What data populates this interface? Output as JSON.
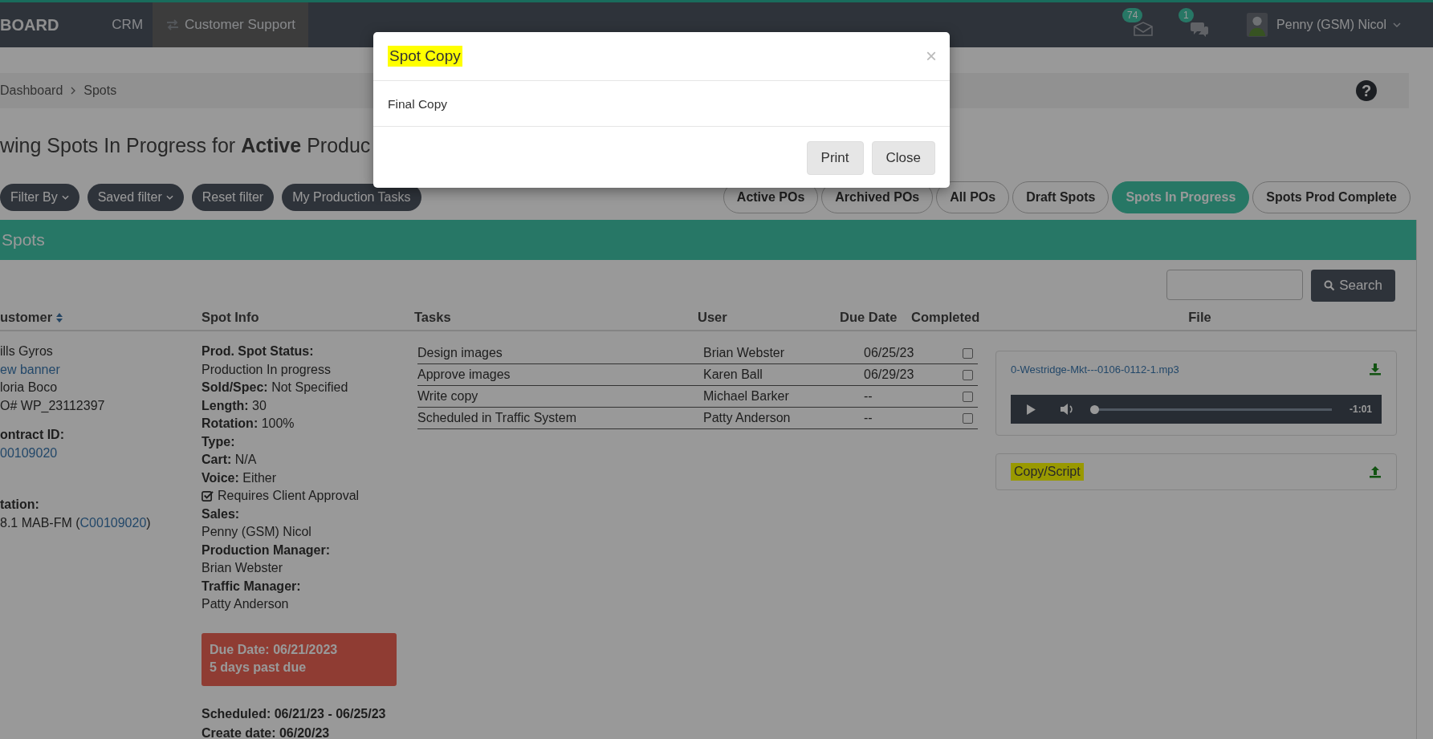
{
  "topbar": {
    "brand": "BOARD",
    "nav": [
      {
        "label": "CRM",
        "selected": false
      },
      {
        "label": "Customer Support",
        "selected": true
      }
    ],
    "mail_badge": "74",
    "chat_badge": "1",
    "user": "Penny (GSM) Nicol"
  },
  "breadcrumb": [
    "Dashboard",
    "Spots"
  ],
  "help": "?",
  "heading": "wing Spots In Progress for **Active** Produc",
  "filters": [
    {
      "label": "Filter By",
      "dropdown": true
    },
    {
      "label": "Saved filter",
      "dropdown": true
    },
    {
      "label": "Reset filter",
      "dropdown": false
    },
    {
      "label": "My Production Tasks",
      "dropdown": false
    }
  ],
  "tabs": [
    {
      "label": "Active POs",
      "selected": false
    },
    {
      "label": "Archived POs",
      "selected": false
    },
    {
      "label": "All POs",
      "selected": false
    },
    {
      "label": "Draft Spots",
      "selected": false
    },
    {
      "label": "Spots In Progress",
      "selected": true
    },
    {
      "label": "Spots Prod Complete",
      "selected": false
    }
  ],
  "panel": {
    "title": "Spots",
    "search_button": "Search"
  },
  "table": {
    "columns": [
      {
        "label": "ustomer",
        "sortable": true
      },
      {
        "label": "Spot Info",
        "sortable": false
      },
      {
        "label": "Tasks",
        "sortable": false
      },
      {
        "label": "User",
        "sortable": false
      },
      {
        "label": "Due Date",
        "sortable": false
      },
      {
        "label": "Completed",
        "sortable": false
      },
      {
        "label": "File",
        "sortable": false
      }
    ],
    "customer": [
      {
        "kind": "text",
        "text": "ills Gyros"
      },
      {
        "kind": "link",
        "text": "ew banner"
      },
      {
        "kind": "text",
        "text": "loria Boco"
      },
      {
        "kind": "text",
        "text": "O# WP_23112397"
      },
      {
        "kind": "label",
        "text": "ontract ID:"
      },
      {
        "kind": "link",
        "text": "00109020"
      },
      {
        "kind": "label",
        "text": "tation:"
      },
      {
        "kind": "station",
        "text": "8.1 MAB-FM (",
        "link": "C00109020",
        "after": ")"
      }
    ],
    "spot_info": [
      {
        "kind": "label",
        "text": "Prod. Spot Status:"
      },
      {
        "kind": "value",
        "text": "Production In progress"
      },
      {
        "kind": "rich",
        "text": "**Sold/Spec:** Not Specified"
      },
      {
        "kind": "rich",
        "text": "**Length:** 30"
      },
      {
        "kind": "rich",
        "text": "**Rotation:** 100%"
      },
      {
        "kind": "rich",
        "text": "**Type:**"
      },
      {
        "kind": "rich",
        "text": "**Cart:** N/A"
      },
      {
        "kind": "rich",
        "text": "**Voice:** Either"
      },
      {
        "kind": "check",
        "text": "Requires Client Approval",
        "checked": true
      },
      {
        "kind": "label",
        "text": "Sales:"
      },
      {
        "kind": "value",
        "text": "Penny (GSM) Nicol"
      },
      {
        "kind": "label",
        "text": "Production Manager:"
      },
      {
        "kind": "value",
        "text": "Brian Webster"
      },
      {
        "kind": "label",
        "text": "Traffic Manager:"
      },
      {
        "kind": "value",
        "text": "Patty Anderson"
      }
    ],
    "due": {
      "date": "Due Date: 06/21/2023",
      "overdue": "5 days past due"
    },
    "dates": [
      "Scheduled: 06/21/23 - 06/25/23",
      "Create date: 06/20/23"
    ],
    "tasks": [
      {
        "task": "Design images",
        "user": "Brian Webster",
        "due": "06/25/23",
        "completed": false
      },
      {
        "task": "Approve images",
        "user": "Karen Ball",
        "due": "06/29/23",
        "completed": false
      },
      {
        "task": "Write copy",
        "user": "Michael Barker",
        "due": "--",
        "completed": false
      },
      {
        "task": "Scheduled in Traffic System",
        "user": "Patty Anderson",
        "due": "--",
        "completed": false
      }
    ],
    "file": {
      "name": "0-Westridge-Mkt---0106-0112-1.mp3",
      "time": "-1:01",
      "level": 0
    },
    "copy": {
      "label": "Copy/Script",
      "highlighted": true
    }
  },
  "modal": {
    "title": "Spot Copy",
    "highlighted": true,
    "close": "×",
    "body": "Final Copy",
    "buttons": [
      "Print",
      "Close"
    ]
  }
}
